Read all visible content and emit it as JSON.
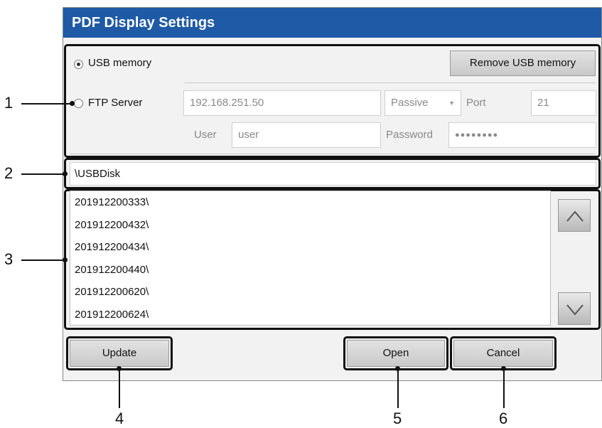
{
  "dialog": {
    "title": "PDF Display Settings"
  },
  "usb": {
    "label": "USB memory",
    "selected": true,
    "remove_button": "Remove USB memory"
  },
  "ftp": {
    "label": "FTP Server",
    "selected": false,
    "ip": "192.168.251.50",
    "mode": "Passive",
    "port_label": "Port",
    "port": "21",
    "user_label": "User",
    "user": "user",
    "password_label": "Password",
    "password": "●●●●●●●●"
  },
  "path": "\\USBDisk",
  "files": [
    "201912200333\\",
    "201912200432\\",
    "201912200434\\",
    "201912200440\\",
    "201912200620\\",
    "201912200624\\"
  ],
  "buttons": {
    "update": "Update",
    "open": "Open",
    "cancel": "Cancel"
  },
  "callouts": [
    "1",
    "2",
    "3",
    "4",
    "5",
    "6"
  ],
  "colors": {
    "titlebar": "#1f5aa6",
    "callout": "#111111"
  }
}
